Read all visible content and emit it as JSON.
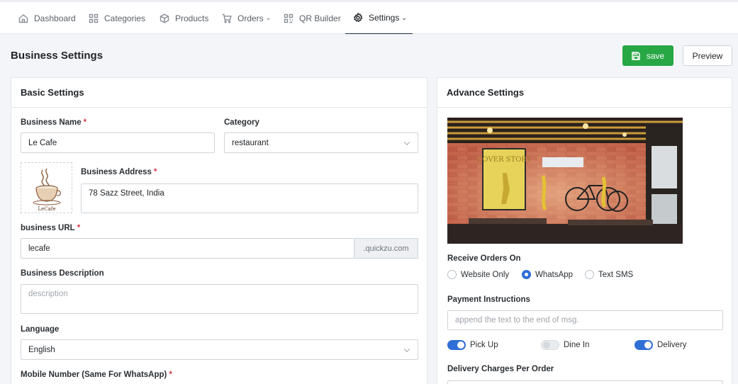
{
  "nav": {
    "items": [
      {
        "label": "Dashboard",
        "icon": "home-icon"
      },
      {
        "label": "Categories",
        "icon": "grid-icon"
      },
      {
        "label": "Products",
        "icon": "box-icon"
      },
      {
        "label": "Orders",
        "icon": "cart-icon",
        "dropdown": "⌄"
      },
      {
        "label": "QR Builder",
        "icon": "qr-icon"
      },
      {
        "label": "Settings",
        "icon": "gear-icon",
        "dropdown": "⌄",
        "active": true
      }
    ]
  },
  "header": {
    "title": "Business Settings",
    "save_label": "save",
    "preview_label": "Preview"
  },
  "basic": {
    "title": "Basic Settings",
    "business_name": {
      "label": "Business Name",
      "required": "*",
      "value": "Le Cafe"
    },
    "category": {
      "label": "Category",
      "value": "restaurant"
    },
    "logo": {
      "text": "LeCafe"
    },
    "address": {
      "label": "Business Address",
      "required": "*",
      "value": "78 Sazz Street, India"
    },
    "url": {
      "label": "business URL",
      "required": "*",
      "value": "lecafe",
      "suffix": ".quickzu.com"
    },
    "description": {
      "label": "Business Description",
      "placeholder": "description"
    },
    "language": {
      "label": "Language",
      "value": "English"
    },
    "mobile": {
      "label": "Mobile Number (Same For WhatsApp)",
      "required": "*"
    }
  },
  "advance": {
    "title": "Advance Settings",
    "cover": {
      "sign_text": "COVER STORY"
    },
    "receive_orders": {
      "label": "Receive Orders On",
      "options": [
        "Website Only",
        "WhatsApp",
        "Text SMS"
      ],
      "selected": "WhatsApp"
    },
    "payment": {
      "label": "Payment Instructions",
      "placeholder": "append the text to the end of msg."
    },
    "toggles": [
      {
        "label": "Pick Up",
        "on": true
      },
      {
        "label": "Dine In",
        "on": false
      },
      {
        "label": "Delivery",
        "on": true
      }
    ],
    "delivery_charges": {
      "label": "Delivery Charges Per Order"
    }
  },
  "colors": {
    "accent": "#2f6fd6",
    "save_button": "#28a745",
    "required": "#dc3545"
  }
}
